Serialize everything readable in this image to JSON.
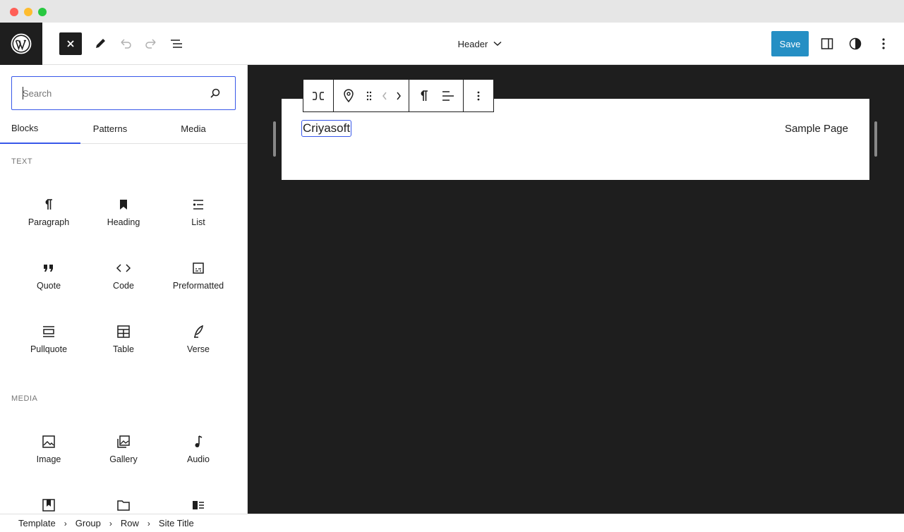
{
  "header": {
    "document_title": "Header",
    "save_label": "Save"
  },
  "sidebar": {
    "search": {
      "placeholder": "Search"
    },
    "tabs": [
      {
        "label": "Blocks",
        "active": true
      },
      {
        "label": "Patterns",
        "active": false
      },
      {
        "label": "Media",
        "active": false
      }
    ],
    "sections": [
      {
        "heading": "TEXT",
        "blocks": [
          {
            "label": "Paragraph",
            "icon": "paragraph-icon"
          },
          {
            "label": "Heading",
            "icon": "heading-icon"
          },
          {
            "label": "List",
            "icon": "list-icon"
          },
          {
            "label": "Quote",
            "icon": "quote-icon"
          },
          {
            "label": "Code",
            "icon": "code-icon"
          },
          {
            "label": "Preformatted",
            "icon": "preformatted-icon"
          },
          {
            "label": "Pullquote",
            "icon": "pullquote-icon"
          },
          {
            "label": "Table",
            "icon": "table-icon"
          },
          {
            "label": "Verse",
            "icon": "verse-icon"
          }
        ]
      },
      {
        "heading": "MEDIA",
        "blocks": [
          {
            "label": "Image",
            "icon": "image-icon"
          },
          {
            "label": "Gallery",
            "icon": "gallery-icon"
          },
          {
            "label": "Audio",
            "icon": "audio-icon"
          },
          {
            "label": "",
            "icon": "cover-icon"
          },
          {
            "label": "",
            "icon": "file-icon"
          },
          {
            "label": "",
            "icon": "media-text-icon"
          }
        ]
      }
    ]
  },
  "canvas": {
    "site_title": "Criyasoft",
    "nav_link": "Sample Page"
  },
  "breadcrumb": [
    "Template",
    "Group",
    "Row",
    "Site Title"
  ],
  "colors": {
    "accent": "#3858e9",
    "save": "#007cba",
    "canvas_bg": "#1e1e1e"
  }
}
